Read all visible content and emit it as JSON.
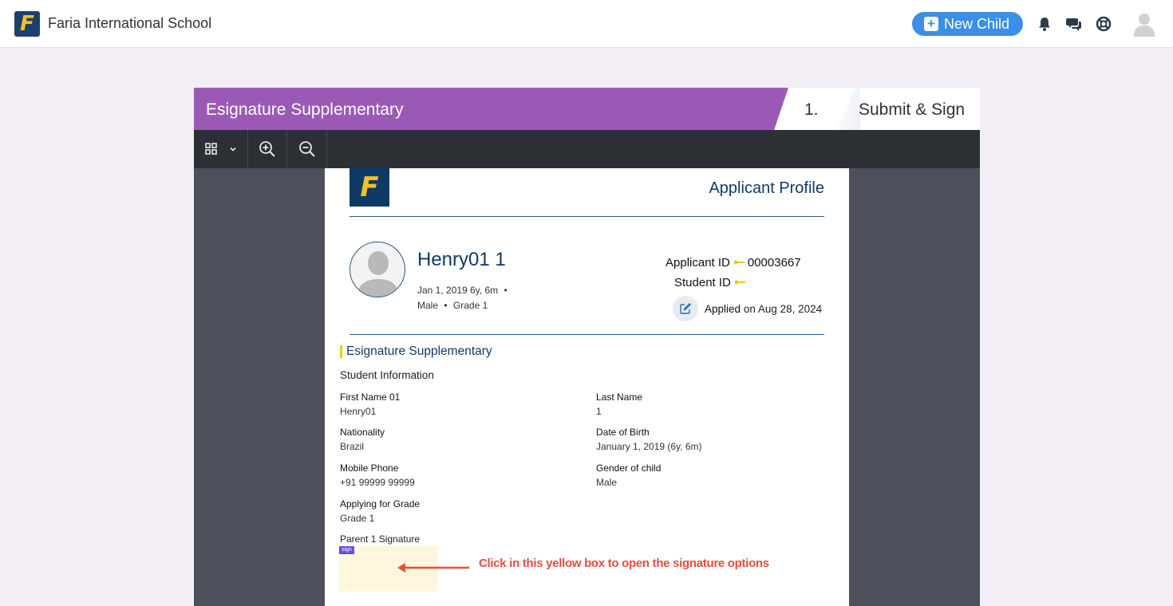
{
  "header": {
    "logo_letter": "F",
    "school_name": "Faria International School",
    "new_child_label": "New Child",
    "icons": [
      "bell-icon",
      "chat-icon",
      "help-lifebuoy-icon",
      "user-avatar-icon"
    ]
  },
  "form": {
    "title": "Esignature Supplementary",
    "step_number": "1.",
    "step_label": "Submit & Sign"
  },
  "toolbar": {
    "icons": [
      "grid-view-icon",
      "chevron-down-icon",
      "zoom-in-icon",
      "zoom-out-icon"
    ]
  },
  "document": {
    "logo_letter": "F",
    "heading": "Applicant Profile",
    "applicant": {
      "name": "Henry01 1",
      "dob_age": "Jan 1, 2019 6y, 6m",
      "gender": "Male",
      "grade": "Grade 1",
      "applicant_id_label": "Applicant ID",
      "applicant_id": "00003667",
      "student_id_label": "Student ID",
      "applied_label": "Applied",
      "applied_date": "on Aug 28, 2024"
    },
    "section_title": "Esignature Supplementary",
    "subsection_title": "Student Information",
    "fields": {
      "first_name_label": "First Name 01",
      "first_name": "Henry01",
      "last_name_label": "Last Name",
      "last_name": "1",
      "nationality_label": "Nationality",
      "nationality": "Brazil",
      "dob_label": "Date of Birth",
      "dob": "January 1, 2019 (6y, 6m)",
      "mobile_label": "Mobile Phone",
      "mobile": "+91 99999 99999",
      "gender_label": "Gender of child",
      "gender": "Male",
      "grade_label": "Applying for Grade",
      "grade": "Grade 1",
      "signature_label": "Parent 1 Signature",
      "sign_tag": "sign"
    }
  },
  "annotation": {
    "text": "Click in this yellow box to open the signature options",
    "color": "#e74c3c"
  },
  "colors": {
    "brand_purple": "#9b59b6",
    "navy": "#0e3a66",
    "accent_blue": "#3b8fe4",
    "gold": "#f5c11b",
    "signature_box": "#fff6dd"
  }
}
